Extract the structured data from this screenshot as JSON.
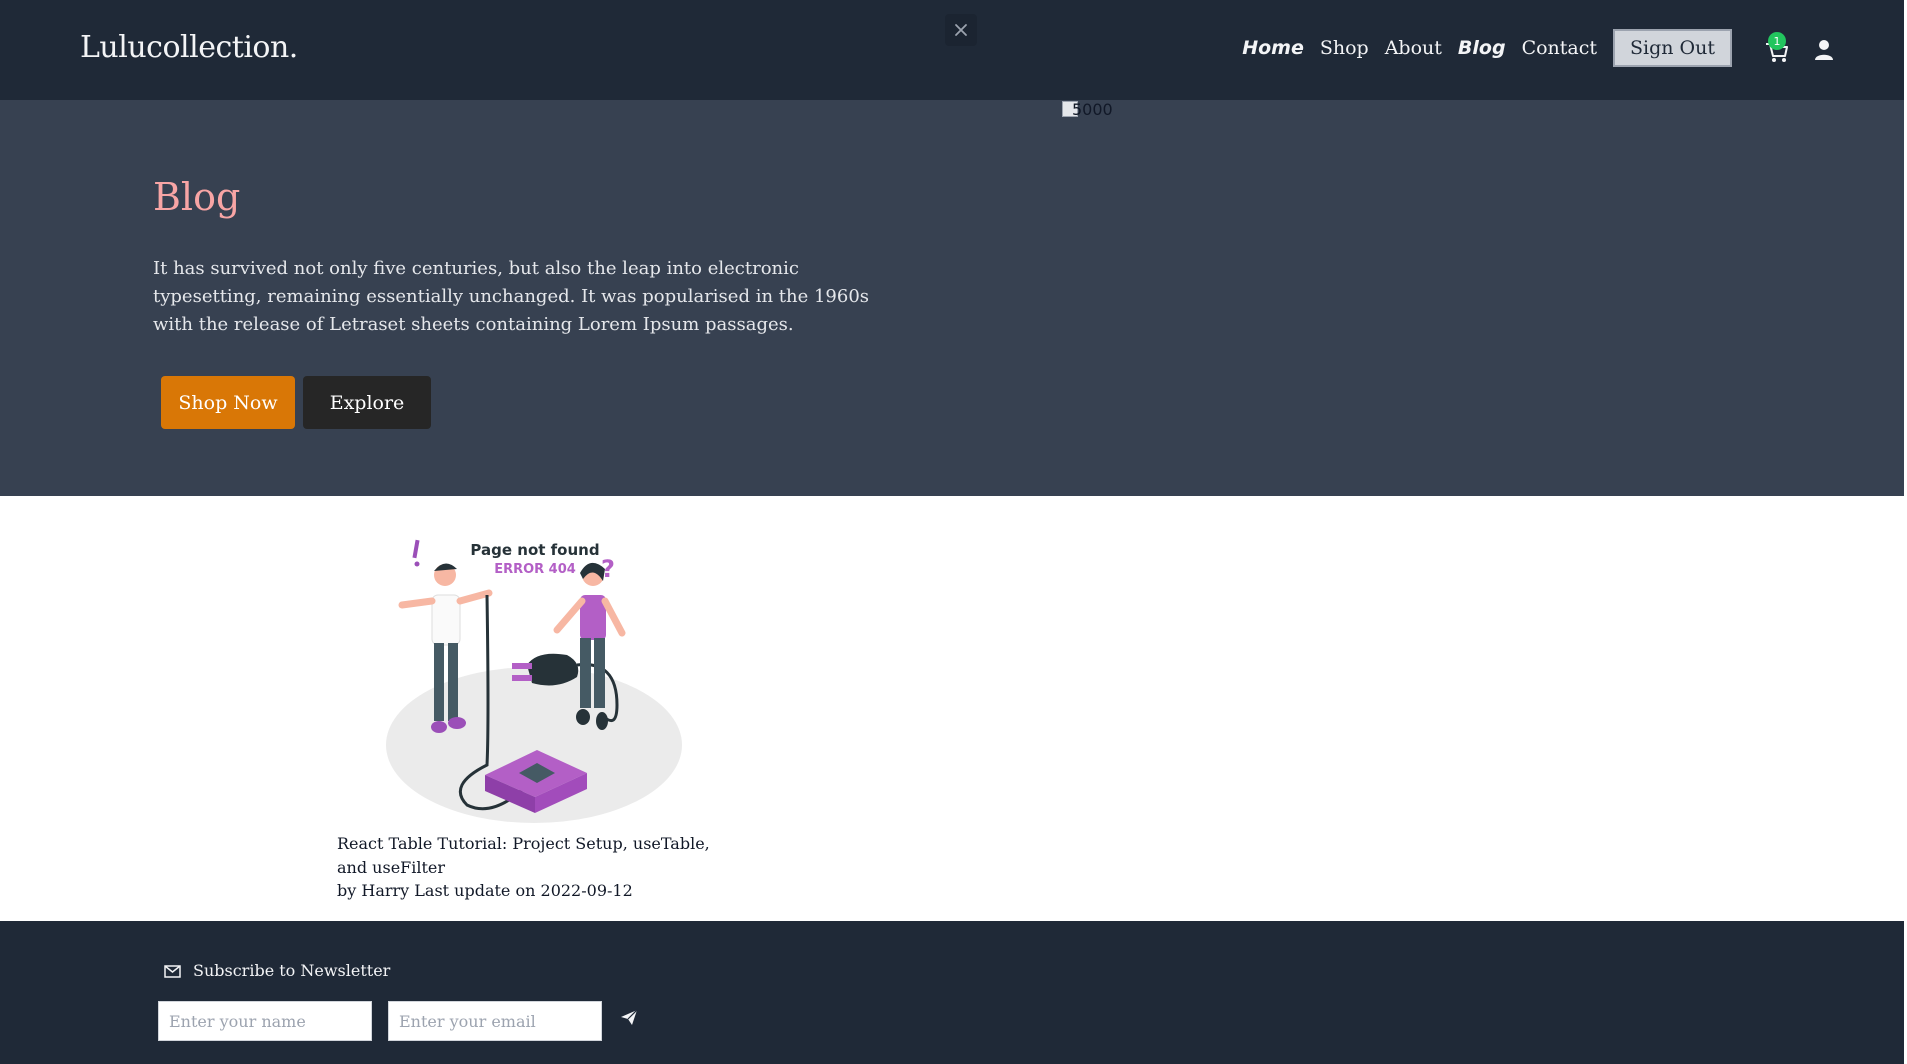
{
  "navbar": {
    "brand": "Lulucollection.",
    "close_icon": "close-icon",
    "links": [
      {
        "label": "Home",
        "style": "emph"
      },
      {
        "label": "Shop",
        "style": "plain"
      },
      {
        "label": "About",
        "style": "plain"
      },
      {
        "label": "Blog",
        "style": "emph"
      },
      {
        "label": "Contact",
        "style": "plain"
      }
    ],
    "signout_label": "Sign Out",
    "cart_icon": "cart-icon",
    "cart_count": "1",
    "user_icon": "user-icon"
  },
  "hero": {
    "image_alt": "5000",
    "title": "Blog",
    "description": "It has survived not only five centuries, but also the leap into electronic typesetting, remaining essentially unchanged. It was popularised in the 1960s with the release of Letraset sheets containing Lorem Ipsum passages.",
    "shop_label": "Shop Now",
    "explore_label": "Explore"
  },
  "blog_card": {
    "image_title": "Page not found",
    "image_subtitle": "ERROR 404",
    "title": "React Table Tutorial: Project Setup, useTable, and useFilter",
    "meta": "by Harry Last update on 2022-09-12"
  },
  "footer": {
    "newsletter_icon": "mail-icon",
    "newsletter_label": "Subscribe to Newsletter",
    "name_placeholder": "Enter your name",
    "email_placeholder": "Enter your email",
    "send_icon": "send-icon"
  },
  "colors": {
    "navbar_bg": "#1f2937",
    "hero_bg": "#374151",
    "hero_title": "#f8a5a5",
    "shop_button": "#d97706",
    "explore_button": "#262626",
    "badge": "#22c55e"
  }
}
